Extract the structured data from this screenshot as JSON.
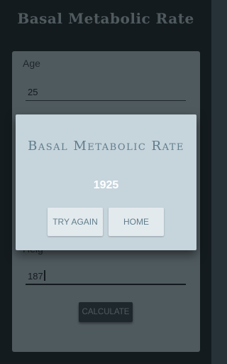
{
  "app": {
    "title": "Basal Metabolic Rate"
  },
  "form": {
    "age": {
      "label": "Age",
      "value": "25"
    },
    "height": {
      "label_partial": "Heig",
      "value": "187"
    },
    "calculate_label": "CALCULATE"
  },
  "dialog": {
    "title": "Basal Metabolic Rate",
    "result": "1925",
    "try_again_label": "TRY AGAIN",
    "home_label": "HOME"
  }
}
